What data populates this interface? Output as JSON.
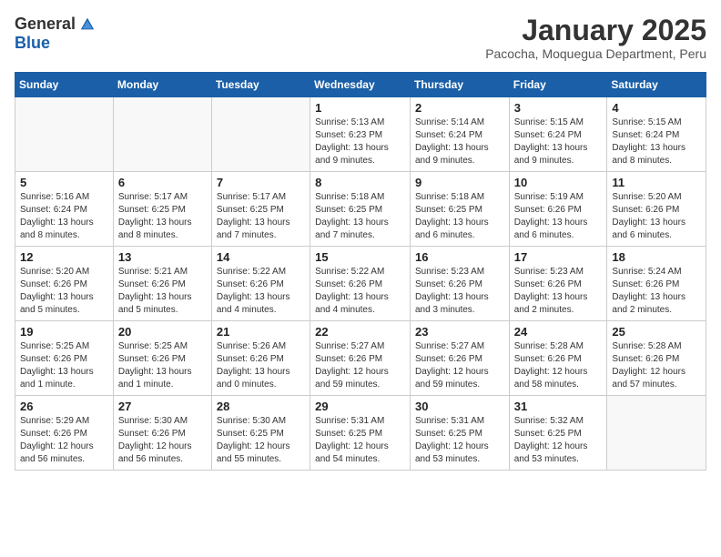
{
  "logo": {
    "general": "General",
    "blue": "Blue"
  },
  "title": "January 2025",
  "subtitle": "Pacocha, Moquegua Department, Peru",
  "weekdays": [
    "Sunday",
    "Monday",
    "Tuesday",
    "Wednesday",
    "Thursday",
    "Friday",
    "Saturday"
  ],
  "weeks": [
    [
      {
        "day": "",
        "detail": ""
      },
      {
        "day": "",
        "detail": ""
      },
      {
        "day": "",
        "detail": ""
      },
      {
        "day": "1",
        "detail": "Sunrise: 5:13 AM\nSunset: 6:23 PM\nDaylight: 13 hours\nand 9 minutes."
      },
      {
        "day": "2",
        "detail": "Sunrise: 5:14 AM\nSunset: 6:24 PM\nDaylight: 13 hours\nand 9 minutes."
      },
      {
        "day": "3",
        "detail": "Sunrise: 5:15 AM\nSunset: 6:24 PM\nDaylight: 13 hours\nand 9 minutes."
      },
      {
        "day": "4",
        "detail": "Sunrise: 5:15 AM\nSunset: 6:24 PM\nDaylight: 13 hours\nand 8 minutes."
      }
    ],
    [
      {
        "day": "5",
        "detail": "Sunrise: 5:16 AM\nSunset: 6:24 PM\nDaylight: 13 hours\nand 8 minutes."
      },
      {
        "day": "6",
        "detail": "Sunrise: 5:17 AM\nSunset: 6:25 PM\nDaylight: 13 hours\nand 8 minutes."
      },
      {
        "day": "7",
        "detail": "Sunrise: 5:17 AM\nSunset: 6:25 PM\nDaylight: 13 hours\nand 7 minutes."
      },
      {
        "day": "8",
        "detail": "Sunrise: 5:18 AM\nSunset: 6:25 PM\nDaylight: 13 hours\nand 7 minutes."
      },
      {
        "day": "9",
        "detail": "Sunrise: 5:18 AM\nSunset: 6:25 PM\nDaylight: 13 hours\nand 6 minutes."
      },
      {
        "day": "10",
        "detail": "Sunrise: 5:19 AM\nSunset: 6:26 PM\nDaylight: 13 hours\nand 6 minutes."
      },
      {
        "day": "11",
        "detail": "Sunrise: 5:20 AM\nSunset: 6:26 PM\nDaylight: 13 hours\nand 6 minutes."
      }
    ],
    [
      {
        "day": "12",
        "detail": "Sunrise: 5:20 AM\nSunset: 6:26 PM\nDaylight: 13 hours\nand 5 minutes."
      },
      {
        "day": "13",
        "detail": "Sunrise: 5:21 AM\nSunset: 6:26 PM\nDaylight: 13 hours\nand 5 minutes."
      },
      {
        "day": "14",
        "detail": "Sunrise: 5:22 AM\nSunset: 6:26 PM\nDaylight: 13 hours\nand 4 minutes."
      },
      {
        "day": "15",
        "detail": "Sunrise: 5:22 AM\nSunset: 6:26 PM\nDaylight: 13 hours\nand 4 minutes."
      },
      {
        "day": "16",
        "detail": "Sunrise: 5:23 AM\nSunset: 6:26 PM\nDaylight: 13 hours\nand 3 minutes."
      },
      {
        "day": "17",
        "detail": "Sunrise: 5:23 AM\nSunset: 6:26 PM\nDaylight: 13 hours\nand 2 minutes."
      },
      {
        "day": "18",
        "detail": "Sunrise: 5:24 AM\nSunset: 6:26 PM\nDaylight: 13 hours\nand 2 minutes."
      }
    ],
    [
      {
        "day": "19",
        "detail": "Sunrise: 5:25 AM\nSunset: 6:26 PM\nDaylight: 13 hours\nand 1 minute."
      },
      {
        "day": "20",
        "detail": "Sunrise: 5:25 AM\nSunset: 6:26 PM\nDaylight: 13 hours\nand 1 minute."
      },
      {
        "day": "21",
        "detail": "Sunrise: 5:26 AM\nSunset: 6:26 PM\nDaylight: 13 hours\nand 0 minutes."
      },
      {
        "day": "22",
        "detail": "Sunrise: 5:27 AM\nSunset: 6:26 PM\nDaylight: 12 hours\nand 59 minutes."
      },
      {
        "day": "23",
        "detail": "Sunrise: 5:27 AM\nSunset: 6:26 PM\nDaylight: 12 hours\nand 59 minutes."
      },
      {
        "day": "24",
        "detail": "Sunrise: 5:28 AM\nSunset: 6:26 PM\nDaylight: 12 hours\nand 58 minutes."
      },
      {
        "day": "25",
        "detail": "Sunrise: 5:28 AM\nSunset: 6:26 PM\nDaylight: 12 hours\nand 57 minutes."
      }
    ],
    [
      {
        "day": "26",
        "detail": "Sunrise: 5:29 AM\nSunset: 6:26 PM\nDaylight: 12 hours\nand 56 minutes."
      },
      {
        "day": "27",
        "detail": "Sunrise: 5:30 AM\nSunset: 6:26 PM\nDaylight: 12 hours\nand 56 minutes."
      },
      {
        "day": "28",
        "detail": "Sunrise: 5:30 AM\nSunset: 6:25 PM\nDaylight: 12 hours\nand 55 minutes."
      },
      {
        "day": "29",
        "detail": "Sunrise: 5:31 AM\nSunset: 6:25 PM\nDaylight: 12 hours\nand 54 minutes."
      },
      {
        "day": "30",
        "detail": "Sunrise: 5:31 AM\nSunset: 6:25 PM\nDaylight: 12 hours\nand 53 minutes."
      },
      {
        "day": "31",
        "detail": "Sunrise: 5:32 AM\nSunset: 6:25 PM\nDaylight: 12 hours\nand 53 minutes."
      },
      {
        "day": "",
        "detail": ""
      }
    ]
  ]
}
